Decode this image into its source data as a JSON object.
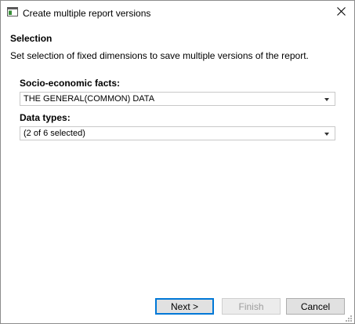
{
  "window": {
    "title": "Create multiple report versions",
    "icon": "dialog-app-icon",
    "close_icon": "close-icon"
  },
  "section": {
    "heading": "Selection",
    "description": "Set selection of fixed dimensions to save multiple versions of the report."
  },
  "fields": [
    {
      "label": "Socio-economic facts:",
      "value": "THE GENERAL(COMMON) DATA"
    },
    {
      "label": "Data types:",
      "value": "(2 of 6 selected)"
    }
  ],
  "buttons": {
    "next": "Next >",
    "finish": "Finish",
    "cancel": "Cancel"
  },
  "colors": {
    "accent": "#0078d7",
    "disabled_text": "#9d9d9d"
  }
}
